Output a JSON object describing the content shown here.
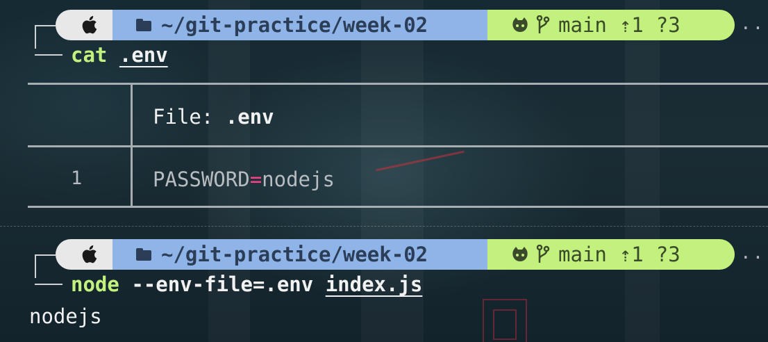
{
  "prompt": {
    "path": "~/git-practice/week-02",
    "branch": "main",
    "ahead": "⇡1",
    "untracked": "?3",
    "overflow": "··",
    "icons": [
      "apple-icon",
      "folder-icon",
      "github-icon",
      "branch-icon"
    ]
  },
  "commands": [
    {
      "program": "cat",
      "args": ".env"
    },
    {
      "program": "node",
      "args_plain": "--env-file=.env",
      "args_underlined": "index.js"
    }
  ],
  "file_view": {
    "header_label": "File: ",
    "file_name": ".env",
    "lines": [
      {
        "number": "1",
        "key": "PASSWORD",
        "eq": "=",
        "value": "nodejs"
      }
    ]
  },
  "output": "nodejs",
  "colors": {
    "apple_segment": "#e8e8e8",
    "path_segment": "#8fb4e8",
    "git_segment": "#c2f27d",
    "command_program": "#c2f27d",
    "equals_highlight": "#ff3f86"
  }
}
